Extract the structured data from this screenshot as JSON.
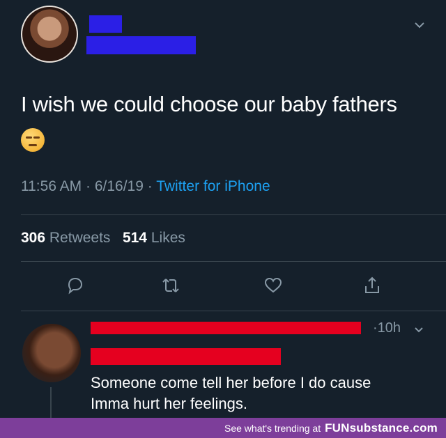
{
  "tweet": {
    "text": "I wish we could choose our baby fathers",
    "time": "11:56 AM",
    "date": "6/16/19",
    "source": "Twitter for iPhone",
    "retweets_count": "306",
    "retweets_label": "Retweets",
    "likes_count": "514",
    "likes_label": "Likes"
  },
  "reply": {
    "time": "10h",
    "text_line1": "Someone come tell her before I do cause",
    "text_line2": "Imma hurt her feelings."
  },
  "footer": {
    "prefix": "See what's trending at",
    "brand": "FUNsubstance.com"
  },
  "icons": [
    "chevron-down-icon",
    "reply-icon",
    "retweet-icon",
    "like-icon",
    "share-icon"
  ],
  "colors": {
    "background": "#15202b",
    "muted": "#8899a6",
    "link": "#1da1f2",
    "banner": "#7d3e9a"
  }
}
